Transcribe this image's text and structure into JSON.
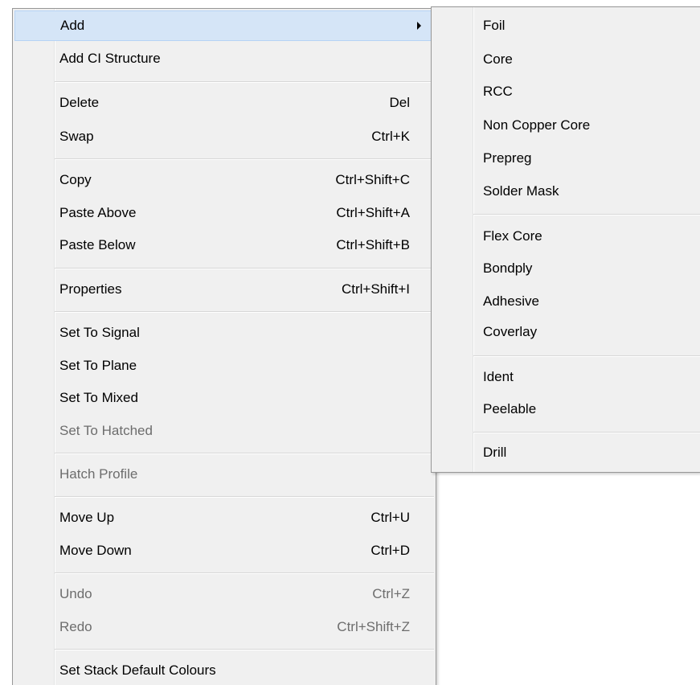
{
  "context_menu": {
    "items": [
      {
        "label": "Add",
        "shortcut": "",
        "enabled": true,
        "has_submenu": true,
        "highlighted": true
      },
      {
        "label": "Add CI Structure",
        "shortcut": "",
        "enabled": true
      },
      {
        "label": "Delete",
        "shortcut": "Del",
        "enabled": true
      },
      {
        "label": "Swap",
        "shortcut": "Ctrl+K",
        "enabled": true
      },
      {
        "label": "Copy",
        "shortcut": "Ctrl+Shift+C",
        "enabled": true
      },
      {
        "label": "Paste Above",
        "shortcut": "Ctrl+Shift+A",
        "enabled": true
      },
      {
        "label": "Paste Below",
        "shortcut": "Ctrl+Shift+B",
        "enabled": true
      },
      {
        "label": "Properties",
        "shortcut": "Ctrl+Shift+I",
        "enabled": true
      },
      {
        "label": "Set To Signal",
        "shortcut": "",
        "enabled": true
      },
      {
        "label": "Set To Plane",
        "shortcut": "",
        "enabled": true
      },
      {
        "label": "Set To Mixed",
        "shortcut": "",
        "enabled": true
      },
      {
        "label": "Set To Hatched",
        "shortcut": "",
        "enabled": false
      },
      {
        "label": "Hatch Profile",
        "shortcut": "",
        "enabled": false
      },
      {
        "label": "Move Up",
        "shortcut": "Ctrl+U",
        "enabled": true
      },
      {
        "label": "Move Down",
        "shortcut": "Ctrl+D",
        "enabled": true
      },
      {
        "label": "Undo",
        "shortcut": "Ctrl+Z",
        "enabled": false
      },
      {
        "label": "Redo",
        "shortcut": "Ctrl+Shift+Z",
        "enabled": false
      },
      {
        "label": "Set Stack Default Colours",
        "shortcut": "",
        "enabled": true
      }
    ]
  },
  "add_submenu": {
    "items": [
      {
        "label": "Foil"
      },
      {
        "label": "Core"
      },
      {
        "label": "RCC"
      },
      {
        "label": "Non Copper Core"
      },
      {
        "label": "Prepreg"
      },
      {
        "label": "Solder Mask"
      },
      {
        "label": "Flex Core"
      },
      {
        "label": "Bondply"
      },
      {
        "label": "Adhesive"
      },
      {
        "label": "Coverlay"
      },
      {
        "label": "Ident"
      },
      {
        "label": "Peelable"
      },
      {
        "label": "Drill"
      }
    ]
  },
  "colors": {
    "menu_background": "#f0f0f0",
    "highlight": "#d5e5f7",
    "highlight_border": "#b6d3f5",
    "disabled_text": "#6d6d6d",
    "border": "#979797"
  }
}
